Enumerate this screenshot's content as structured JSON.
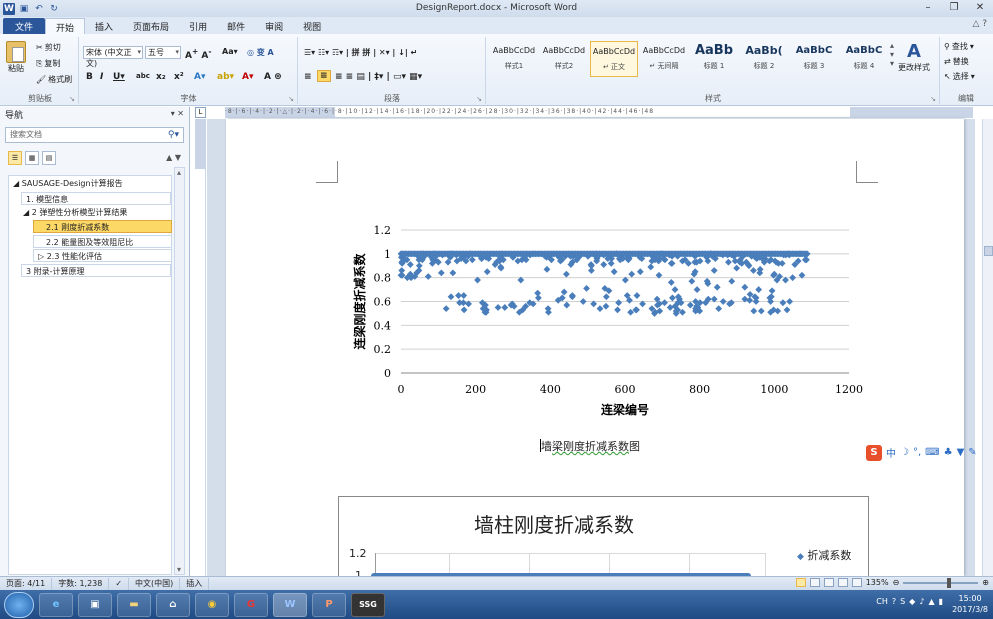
{
  "titlebar": {
    "title": "DesignReport.docx - Microsoft Word",
    "app_logo": "W",
    "qat_icons": [
      "save-icon",
      "undo-icon",
      "redo-icon"
    ]
  },
  "tabs": [
    "文件",
    "开始",
    "插入",
    "页面布局",
    "引用",
    "邮件",
    "审阅",
    "视图"
  ],
  "ribbon": {
    "clipboard": {
      "paste": "粘贴",
      "cut": "剪切",
      "copy": "复制",
      "format_painter": "格式刷",
      "label": "剪贴板"
    },
    "font": {
      "font_name": "宋体 (中文正文)",
      "font_size": "五号",
      "label": "字体"
    },
    "paragraph": {
      "label": "段落"
    },
    "styles": {
      "label": "样式",
      "items": [
        {
          "preview": "AaBbCcDd",
          "name": "样式1"
        },
        {
          "preview": "AaBbCcDd",
          "name": "样式2"
        },
        {
          "preview": "AaBbCcDd",
          "name": "↵ 正文"
        },
        {
          "preview": "AaBbCcDd",
          "name": "↵ 无间隔"
        },
        {
          "preview": "AaBb",
          "name": "标题 1"
        },
        {
          "preview": "AaBb(",
          "name": "标题 2"
        },
        {
          "preview": "AaBbC",
          "name": "标题 3"
        },
        {
          "preview": "AaBbC",
          "name": "标题 4"
        }
      ],
      "change_styles": "更改样式"
    },
    "editing": {
      "find": "查找",
      "replace": "替换",
      "select": "选择",
      "label": "编辑"
    }
  },
  "nav": {
    "title": "导航",
    "search_placeholder": "搜索文档",
    "tree": [
      {
        "label": "◢ SAUSAGE-Design计算报告",
        "level": 0
      },
      {
        "label": "1. 模型信息",
        "level": 1
      },
      {
        "label": "◢ 2 弹塑性分析模型计算结果",
        "level": 1
      },
      {
        "label": "2.1 刚度折减系数",
        "level": 2,
        "selected": true
      },
      {
        "label": "2.2 能量图及等效阻尼比",
        "level": 2
      },
      {
        "label": "▷ 2.3 性能化评估",
        "level": 2
      },
      {
        "label": "3 附录-计算原理",
        "level": 1
      }
    ]
  },
  "chart1": {
    "caption_prefix": "墙",
    "caption_underlined": "梁刚度折减系数",
    "caption_suffix": "图"
  },
  "chart_data": [
    {
      "type": "scatter",
      "title": "",
      "xlabel": "连梁编号",
      "ylabel": "连梁刚度折减系数",
      "xlim": [
        0,
        1200
      ],
      "ylim": [
        0,
        1.2
      ],
      "xticks": [
        "0",
        "200",
        "400",
        "600",
        "800",
        "1000",
        "1200"
      ],
      "yticks": [
        "0",
        "0.2",
        "0.4",
        "0.6",
        "0.8",
        "1",
        "1.2"
      ],
      "grid": "horizontal",
      "marker": "diamond",
      "color": "#4a7ebb",
      "x_range": [
        0,
        1090
      ],
      "value_range": [
        0.5,
        1.0
      ]
    },
    {
      "type": "scatter",
      "title": "墙柱刚度折减系数",
      "legend": [
        "折减系数"
      ],
      "legend_placement": "right",
      "yticks_visible": [
        "1.2",
        "1"
      ],
      "color": "#4a7ebb"
    }
  ],
  "ime": {
    "logo": "S",
    "lang": "中"
  },
  "status": {
    "page": "页面: 4/11",
    "words": "字数: 1,238",
    "language": "中文(中国)",
    "mode": "插入",
    "zoom": "135%"
  },
  "taskbar": {
    "apps": [
      "ie-icon",
      "explorer-icon",
      "folder-icon",
      "app-icon",
      "chrome-icon",
      "game-icon",
      "word-icon",
      "powerpoint-icon",
      "ssg-icon"
    ],
    "ssg_label": "SSG",
    "clock_time": "15:00",
    "clock_date": "2017/3/8"
  }
}
